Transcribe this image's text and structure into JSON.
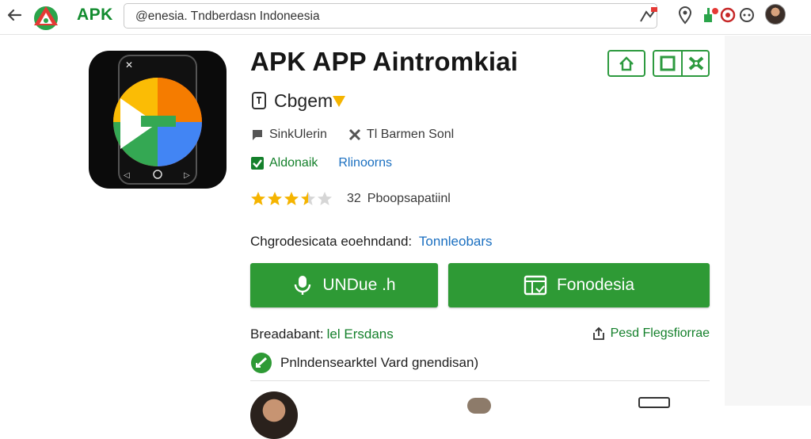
{
  "header": {
    "brand": "APK",
    "url": "@enesia. Tndberdasn Indoneesia"
  },
  "app": {
    "title": "APK APP Aintromkiai",
    "developer": "Cbgem",
    "size_label": "SinkUlerin",
    "category_label": "Tl Barmen Sonl",
    "verified_label": "Aldonaik",
    "tag_link": "Rlinoorns",
    "rating_count": "32",
    "rating_label": "Pboopsapatiinl",
    "rating_value": 3.5,
    "compat_label": "Chgrodesicata eoehndand:",
    "compat_link": "Tonnleobars"
  },
  "actions": {
    "download_label": "UNDue .h",
    "secondary_label": "Fonodesia"
  },
  "details": {
    "label": "Breadabant:",
    "value": "lel Ersdans",
    "report_label": "Pesd Flegsfiorrae",
    "safe_label": "Pnlndensearktel Vard gnendisan)"
  },
  "colors": {
    "accent_green": "#2e9a35",
    "brand_green": "#128c2f",
    "link_blue": "#1a6fc0",
    "star_yellow": "#f5b400"
  }
}
